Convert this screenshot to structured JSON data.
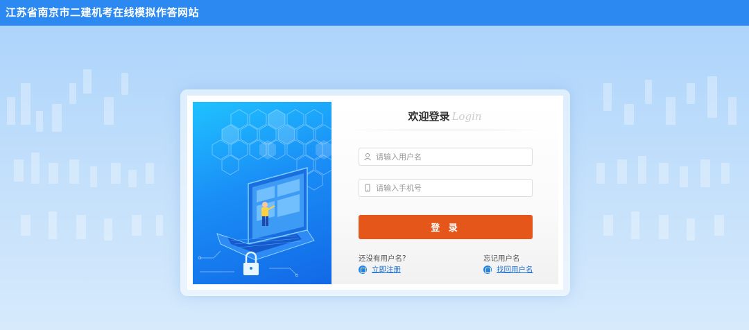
{
  "header": {
    "title": "江苏省南京市二建机考在线模拟作答网站"
  },
  "login": {
    "title_cn": "欢迎登录",
    "title_en": "Login",
    "username_placeholder": "请输入用户名",
    "phone_placeholder": "请输入手机号",
    "submit_label": "登 录",
    "register_question": "还没有用户名?",
    "register_link": "立即注册",
    "forgot_question": "忘记用户名",
    "forgot_link": "找回用户名"
  },
  "colors": {
    "header_bg": "#2b89f1",
    "button_bg": "#e5561b",
    "link": "#1d6fd0"
  },
  "icons": [
    "user-icon",
    "phone-icon",
    "register-icon",
    "retrieve-icon",
    "laptop-illustration",
    "padlock-icon"
  ]
}
